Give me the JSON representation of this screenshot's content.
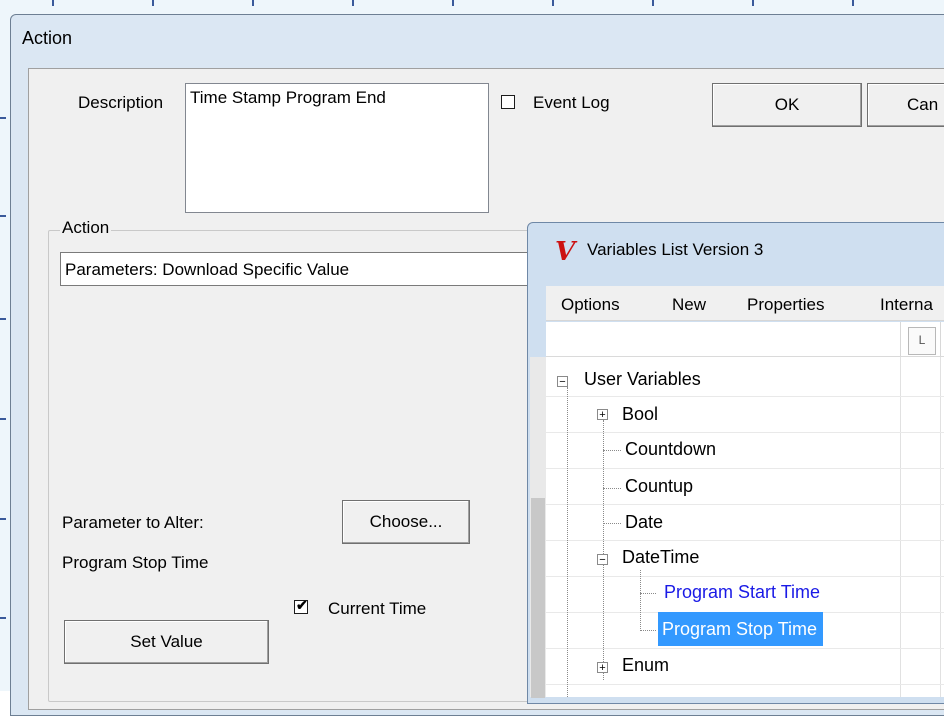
{
  "action_dialog": {
    "title": "Action",
    "description_label": "Description",
    "description_value": "Time Stamp Program End",
    "event_log_label": "Event Log",
    "event_log_checked": false,
    "ok_label": "OK",
    "cancel_label": "Can",
    "action_group_label": "Action",
    "action_type_value": "Parameters: Download Specific Value",
    "parameter_label": "Parameter to Alter:",
    "choose_label": "Choose...",
    "parameter_value": "Program Stop Time",
    "current_time_label": "Current Time",
    "current_time_checked": true,
    "set_value_label": "Set Value"
  },
  "variables_window": {
    "icon": "v-logo-icon",
    "logo_letter": "V",
    "title": "Variables List Version 3",
    "menu": [
      "Options",
      "New",
      "Properties",
      "Interna"
    ],
    "column_header_button": "L",
    "tree": {
      "root": "User Variables",
      "items": [
        {
          "label": "Bool",
          "expandable": true
        },
        {
          "label": "Countdown",
          "expandable": false
        },
        {
          "label": "Countup",
          "expandable": false
        },
        {
          "label": "Date",
          "expandable": false
        },
        {
          "label": "DateTime",
          "expandable": true,
          "expanded": true
        },
        {
          "label": "Program Start Time",
          "child": true
        },
        {
          "label": "Program Stop Time",
          "child": true,
          "selected": true
        },
        {
          "label": "Enum",
          "expandable": true
        }
      ]
    }
  },
  "colors": {
    "selection": "#3399ff",
    "link": "#1a1ae6",
    "logo": "#cc1111"
  }
}
